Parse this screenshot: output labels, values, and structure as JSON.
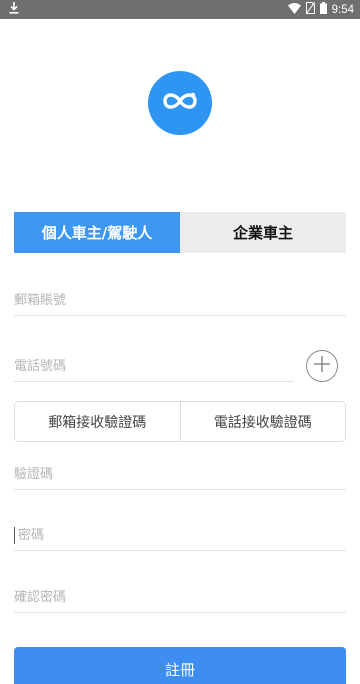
{
  "status_bar": {
    "time": "9:54",
    "icons": [
      "download-icon",
      "wifi-icon",
      "no-sim-icon",
      "battery-icon"
    ]
  },
  "logo": {
    "icon": "infinity-icon",
    "color": "#2f95f2"
  },
  "tabs": [
    {
      "label": "個人車主/駕駛人",
      "active": true
    },
    {
      "label": "企業車主",
      "active": false
    }
  ],
  "form": {
    "email_placeholder": "郵箱賬號",
    "phone_placeholder": "電話號碼",
    "add_icon": "plus-circle-icon",
    "verify_email_label": "郵箱接收驗證碼",
    "verify_phone_label": "電話接收驗證碼",
    "code_placeholder": "驗證碼",
    "password_placeholder": "密碼",
    "confirm_password_placeholder": "確認密碼",
    "register_label": "註冊"
  },
  "colors": {
    "accent": "#3d96f0",
    "tab_inactive": "#ececec",
    "status_bar": "#6f6f6f"
  }
}
